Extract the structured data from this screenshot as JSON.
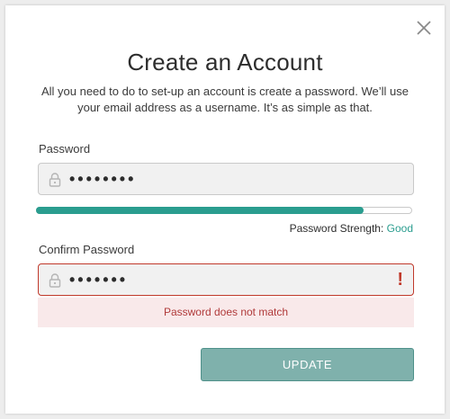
{
  "dialog": {
    "title": "Create an Account",
    "subtitle": "All you need to do to set-up an account is create a password. We’ll use your email address as a username. It’s as simple as that.",
    "close_icon": "close-icon"
  },
  "password": {
    "label": "Password",
    "value": "••••••••",
    "icon": "lock-icon"
  },
  "strength": {
    "prefix": "Password Strength:",
    "level": "Good",
    "fill_fraction": 0.87,
    "color": "#2a9d8f"
  },
  "confirm": {
    "label": "Confirm Password",
    "value": "•••••••",
    "icon": "lock-icon",
    "error_icon": "!",
    "error_message": "Password does not match",
    "error_color": "#c0392b"
  },
  "actions": {
    "update_label": "UPDATE"
  }
}
